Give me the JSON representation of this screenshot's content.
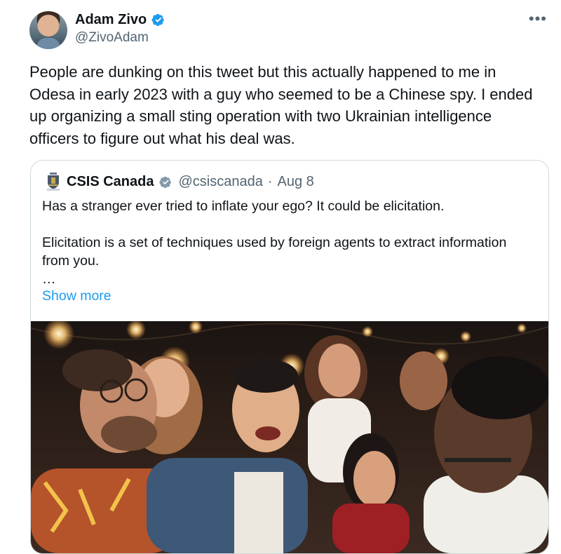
{
  "author": {
    "name": "Adam Zivo",
    "handle": "@ZivoAdam",
    "verified": true,
    "more_icon": "more-horizontal-icon"
  },
  "tweet": {
    "text": "People are dunking on this tweet but this actually happened to me in\nOdesa in early 2023 with a guy who seemed to be a Chinese spy. I ended\nup organizing a small sting operation with two Ukrainian intelligence\nofficers to figure out what his deal was."
  },
  "quoted": {
    "name": "CSIS Canada",
    "handle": "@csiscanada",
    "separator": "·",
    "date": "Aug 8",
    "verified": true,
    "verified_color": "#829aab",
    "text": "Has a stranger ever tried to inflate your ego? It could be elicitation.\n\nElicitation is a set of techniques used by foreign agents to extract information\nfrom you.\n…",
    "show_more": "Show more",
    "media": "photo of a group of friends laughing at a night party"
  },
  "colors": {
    "verified_blue": "#1d9bf0",
    "link": "#1d9bf0",
    "secondary_text": "#536471",
    "border": "#cfd9de"
  }
}
